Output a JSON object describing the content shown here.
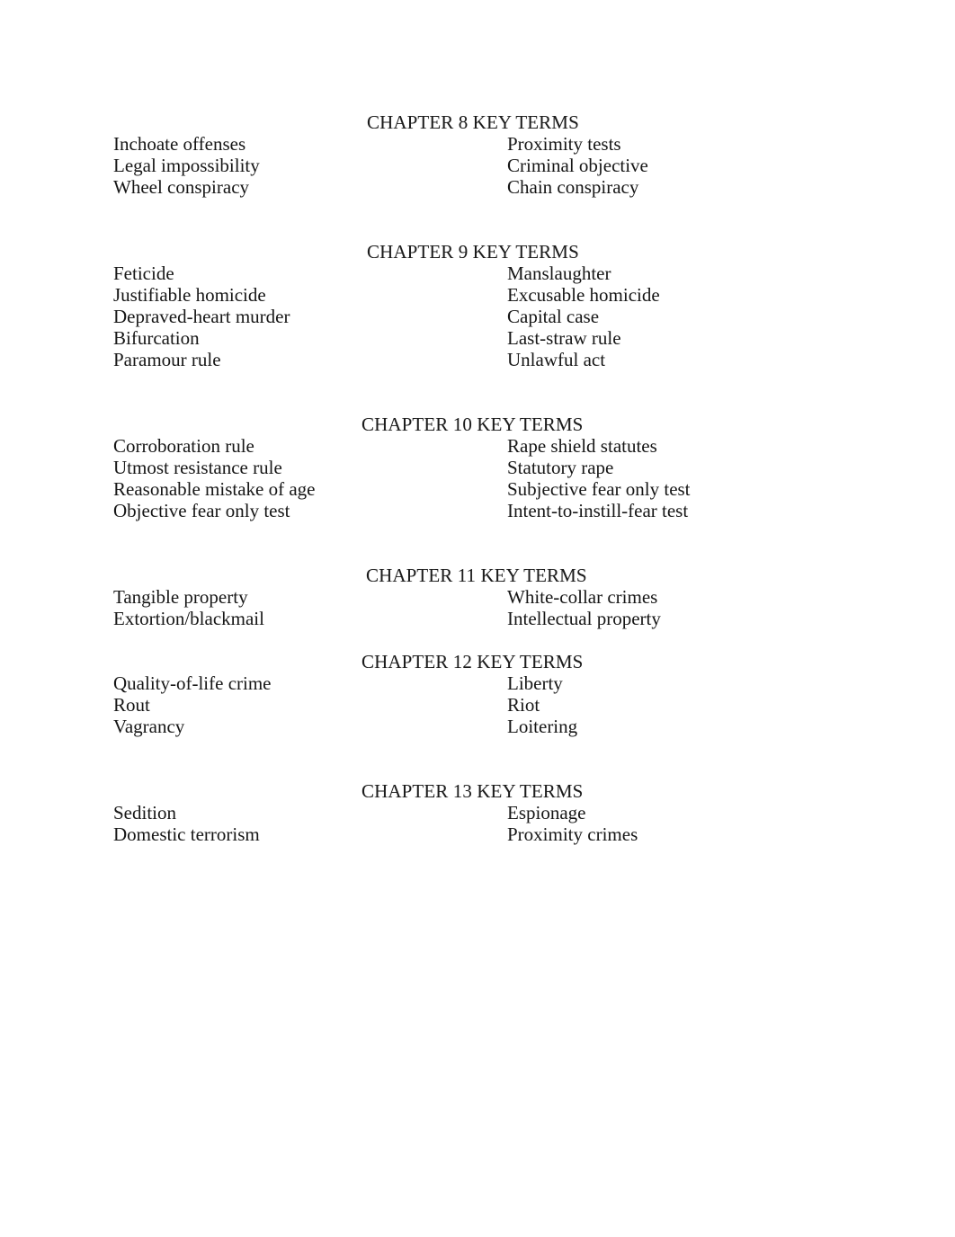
{
  "document": {
    "background_color": "#ffffff",
    "text_color": "#161616",
    "sections": [
      {
        "heading": "CHAPTER 8 KEY TERMS",
        "heading_indent": 408,
        "rows": [
          {
            "left": "Inchoate offenses",
            "right": "Proximity tests"
          },
          {
            "left": "Legal impossibility",
            "right": "Criminal objective"
          },
          {
            "left": "Wheel conspiracy",
            "right": "Chain conspiracy"
          }
        ]
      },
      {
        "heading": "CHAPTER 9 KEY TERMS",
        "heading_indent": 408,
        "rows": [
          {
            "left": "Feticide",
            "right": "Manslaughter"
          },
          {
            "left": "Justifiable homicide",
            "right": "Excusable homicide"
          },
          {
            "left": "Depraved-heart murder",
            "right": "Capital case"
          },
          {
            "left": "Bifurcation",
            "right": "Last-straw rule"
          },
          {
            "left": "Paramour rule",
            "right": "Unlawful act"
          }
        ]
      },
      {
        "heading": "CHAPTER 10 KEY TERMS",
        "heading_indent": 402,
        "rows": [
          {
            "left": "Corroboration rule",
            "right": "Rape shield statutes"
          },
          {
            "left": "Utmost resistance rule",
            "right": "Statutory rape"
          },
          {
            "left": "Reasonable mistake of age",
            "right": "Subjective fear only test"
          },
          {
            "left": "Objective fear only test",
            "right": "Intent-to-instill-fear test"
          }
        ]
      },
      {
        "heading": "CHAPTER 11 KEY TERMS",
        "heading_indent": 407,
        "rows": [
          {
            "left": "Tangible property",
            "right": "White-collar crimes"
          },
          {
            "left": "Extortion/blackmail",
            "right": "Intellectual property"
          }
        ]
      },
      {
        "heading": "CHAPTER 12 KEY TERMS",
        "heading_indent": 402,
        "rows": [
          {
            "left": "Quality-of-life crime",
            "right": "Liberty"
          },
          {
            "left": "Rout",
            "right": "Riot"
          },
          {
            "left": "Vagrancy",
            "right": "Loitering"
          }
        ]
      },
      {
        "heading": "CHAPTER 13 KEY TERMS",
        "heading_indent": 402,
        "rows": [
          {
            "left": "Sedition",
            "right": "Espionage"
          },
          {
            "left": "Domestic terrorism",
            "right": "Proximity crimes"
          }
        ]
      }
    ]
  }
}
